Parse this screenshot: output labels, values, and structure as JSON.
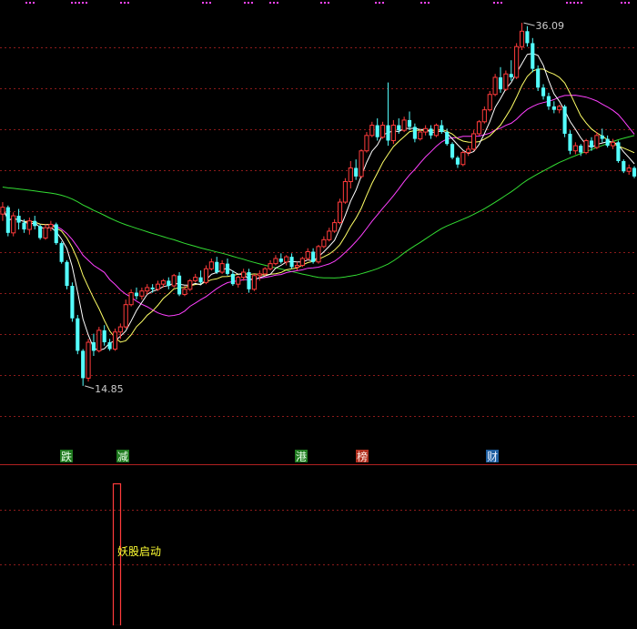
{
  "chart_data": {
    "type": "candlestick",
    "price_range": [
      12.5,
      37.0
    ],
    "max_label": "36.09",
    "min_label": "14.85",
    "max_value": 36.09,
    "min_value": 14.85,
    "colors": {
      "up": "#ff3b3b",
      "down": "#54ffff",
      "ma5": "#ffffff",
      "ma10": "#ffff66",
      "ma20": "#ff40ff",
      "ma60": "#33dd33",
      "grid": "#8b1a1a",
      "top_dots": "#ff44ff",
      "volume_bar": "#ff3b3b",
      "signal_text": "#ffff33"
    },
    "markers": [
      {
        "label": "跌",
        "bg": "#1f7a1f",
        "fg": "#e8ffe8"
      },
      {
        "label": "减",
        "bg": "#1f7a1f",
        "fg": "#e8ffe8"
      },
      {
        "label": "港",
        "bg": "#1f7a1f",
        "fg": "#e8ffe8"
      },
      {
        "label": "榜",
        "bg": "#b03020",
        "fg": "#ffe8e0"
      },
      {
        "label": "财",
        "bg": "#1f5fa0",
        "fg": "#e8f0ff"
      }
    ],
    "signal_label": "妖股启动",
    "candles": [
      [
        24.9,
        25.6,
        24.5,
        25.3
      ],
      [
        25.3,
        25.4,
        23.6,
        23.8
      ],
      [
        23.8,
        25.0,
        23.6,
        24.8
      ],
      [
        24.8,
        25.2,
        24.0,
        24.4
      ],
      [
        24.4,
        24.6,
        23.8,
        24.0
      ],
      [
        24.0,
        24.7,
        23.7,
        24.5
      ],
      [
        24.5,
        24.8,
        24.0,
        24.2
      ],
      [
        24.2,
        24.3,
        23.4,
        23.5
      ],
      [
        23.5,
        24.3,
        23.4,
        24.1
      ],
      [
        24.1,
        24.5,
        23.9,
        24.3
      ],
      [
        24.3,
        24.4,
        23.1,
        23.2
      ],
      [
        23.2,
        23.3,
        22.0,
        22.1
      ],
      [
        22.1,
        22.2,
        20.5,
        20.7
      ],
      [
        20.7,
        20.9,
        18.6,
        18.8
      ],
      [
        18.8,
        19.0,
        16.7,
        16.9
      ],
      [
        16.9,
        17.0,
        14.85,
        15.3
      ],
      [
        15.3,
        17.6,
        15.1,
        17.4
      ],
      [
        17.4,
        17.9,
        16.6,
        16.9
      ],
      [
        16.9,
        18.3,
        16.8,
        18.1
      ],
      [
        18.1,
        18.4,
        17.2,
        17.4
      ],
      [
        17.4,
        17.6,
        16.9,
        17.0
      ],
      [
        17.0,
        18.2,
        16.9,
        18.0
      ],
      [
        18.0,
        18.5,
        17.6,
        18.3
      ],
      [
        18.3,
        19.9,
        18.2,
        19.6
      ],
      [
        19.6,
        20.5,
        19.5,
        20.3
      ],
      [
        20.3,
        20.6,
        19.9,
        20.1
      ],
      [
        20.1,
        20.6,
        19.9,
        20.4
      ],
      [
        20.4,
        20.8,
        20.2,
        20.6
      ],
      [
        20.6,
        20.8,
        20.3,
        20.5
      ],
      [
        20.5,
        21.0,
        20.4,
        20.8
      ],
      [
        20.8,
        21.1,
        20.6,
        21.0
      ],
      [
        21.0,
        21.2,
        20.5,
        20.7
      ],
      [
        20.7,
        21.4,
        20.6,
        21.3
      ],
      [
        21.3,
        21.5,
        20.1,
        20.2
      ],
      [
        20.2,
        20.7,
        20.1,
        20.5
      ],
      [
        20.5,
        21.1,
        20.4,
        21.0
      ],
      [
        21.0,
        21.4,
        20.9,
        21.2
      ],
      [
        21.2,
        21.6,
        20.8,
        20.9
      ],
      [
        20.9,
        21.9,
        20.8,
        21.7
      ],
      [
        21.7,
        22.3,
        21.6,
        22.1
      ],
      [
        22.1,
        22.4,
        21.4,
        21.5
      ],
      [
        21.5,
        22.2,
        21.4,
        22.0
      ],
      [
        22.0,
        22.3,
        21.3,
        21.4
      ],
      [
        21.4,
        21.6,
        20.7,
        20.8
      ],
      [
        20.8,
        21.3,
        20.6,
        21.2
      ],
      [
        21.2,
        21.7,
        21.0,
        21.5
      ],
      [
        21.5,
        21.7,
        20.3,
        20.5
      ],
      [
        20.5,
        21.4,
        20.4,
        21.3
      ],
      [
        21.3,
        21.6,
        21.0,
        21.4
      ],
      [
        21.4,
        21.8,
        21.3,
        21.7
      ],
      [
        21.7,
        22.2,
        21.6,
        22.0
      ],
      [
        22.0,
        22.5,
        21.9,
        22.3
      ],
      [
        22.3,
        22.6,
        22.0,
        22.1
      ],
      [
        22.1,
        22.5,
        21.9,
        22.4
      ],
      [
        22.4,
        22.6,
        21.7,
        21.8
      ],
      [
        21.8,
        22.1,
        21.6,
        21.9
      ],
      [
        21.9,
        22.4,
        21.8,
        22.3
      ],
      [
        22.3,
        22.9,
        22.2,
        22.7
      ],
      [
        22.7,
        22.9,
        22.0,
        22.1
      ],
      [
        22.1,
        23.1,
        22.0,
        23.0
      ],
      [
        23.0,
        23.6,
        22.9,
        23.4
      ],
      [
        23.4,
        24.1,
        23.3,
        23.9
      ],
      [
        23.9,
        24.6,
        23.8,
        24.4
      ],
      [
        24.4,
        25.8,
        24.3,
        25.6
      ],
      [
        25.6,
        27.0,
        25.5,
        26.8
      ],
      [
        26.8,
        28.0,
        26.4,
        27.6
      ],
      [
        27.6,
        28.1,
        26.9,
        27.1
      ],
      [
        27.1,
        28.7,
        27.0,
        28.6
      ],
      [
        28.6,
        29.7,
        28.5,
        29.5
      ],
      [
        29.5,
        30.3,
        29.4,
        30.1
      ],
      [
        30.1,
        30.5,
        29.2,
        29.4
      ],
      [
        29.4,
        30.3,
        29.3,
        30.1
      ],
      [
        30.1,
        32.6,
        28.9,
        29.2
      ],
      [
        29.2,
        30.4,
        29.0,
        30.1
      ],
      [
        30.1,
        30.5,
        29.6,
        29.8
      ],
      [
        29.8,
        30.6,
        29.7,
        30.4
      ],
      [
        30.4,
        30.9,
        29.8,
        30.0
      ],
      [
        30.0,
        30.2,
        29.1,
        29.3
      ],
      [
        29.3,
        29.9,
        29.2,
        29.7
      ],
      [
        29.7,
        30.1,
        29.5,
        29.9
      ],
      [
        29.9,
        30.1,
        29.3,
        29.5
      ],
      [
        29.5,
        30.2,
        29.4,
        30.1
      ],
      [
        30.1,
        30.4,
        29.6,
        29.7
      ],
      [
        29.7,
        29.9,
        28.9,
        29.0
      ],
      [
        29.0,
        29.1,
        28.1,
        28.2
      ],
      [
        28.2,
        28.3,
        27.6,
        27.8
      ],
      [
        27.8,
        28.6,
        27.7,
        28.5
      ],
      [
        28.5,
        28.9,
        28.3,
        28.7
      ],
      [
        28.7,
        29.8,
        28.6,
        29.6
      ],
      [
        29.6,
        30.4,
        29.5,
        30.3
      ],
      [
        30.3,
        31.2,
        30.2,
        31.0
      ],
      [
        31.0,
        32.1,
        30.9,
        31.9
      ],
      [
        31.9,
        33.1,
        31.8,
        32.9
      ],
      [
        32.9,
        33.5,
        32.0,
        32.2
      ],
      [
        32.2,
        33.3,
        32.1,
        33.1
      ],
      [
        33.1,
        33.9,
        32.7,
        32.9
      ],
      [
        32.9,
        34.9,
        32.8,
        34.7
      ],
      [
        34.7,
        36.09,
        34.5,
        35.6
      ],
      [
        35.6,
        35.9,
        34.7,
        34.9
      ],
      [
        34.9,
        35.2,
        33.2,
        33.4
      ],
      [
        33.4,
        33.6,
        32.1,
        32.3
      ],
      [
        32.3,
        32.5,
        31.6,
        31.8
      ],
      [
        31.8,
        32.0,
        31.0,
        31.2
      ],
      [
        31.2,
        31.5,
        30.8,
        31.0
      ],
      [
        31.0,
        31.3,
        30.8,
        31.2
      ],
      [
        31.2,
        31.3,
        29.4,
        29.6
      ],
      [
        29.6,
        29.8,
        28.4,
        28.6
      ],
      [
        28.6,
        29.1,
        28.4,
        28.9
      ],
      [
        28.9,
        29.0,
        28.3,
        28.5
      ],
      [
        28.5,
        29.3,
        28.4,
        29.2
      ],
      [
        29.2,
        29.4,
        28.6,
        28.8
      ],
      [
        28.8,
        29.7,
        28.7,
        29.5
      ],
      [
        29.5,
        29.9,
        29.1,
        29.3
      ],
      [
        29.3,
        29.5,
        28.8,
        28.9
      ],
      [
        28.9,
        29.3,
        28.7,
        29.1
      ],
      [
        29.1,
        29.2,
        27.9,
        28.0
      ],
      [
        28.0,
        28.1,
        27.3,
        27.4
      ],
      [
        27.4,
        27.8,
        27.2,
        27.6
      ],
      [
        27.6,
        27.7,
        27.0,
        27.1
      ]
    ]
  }
}
